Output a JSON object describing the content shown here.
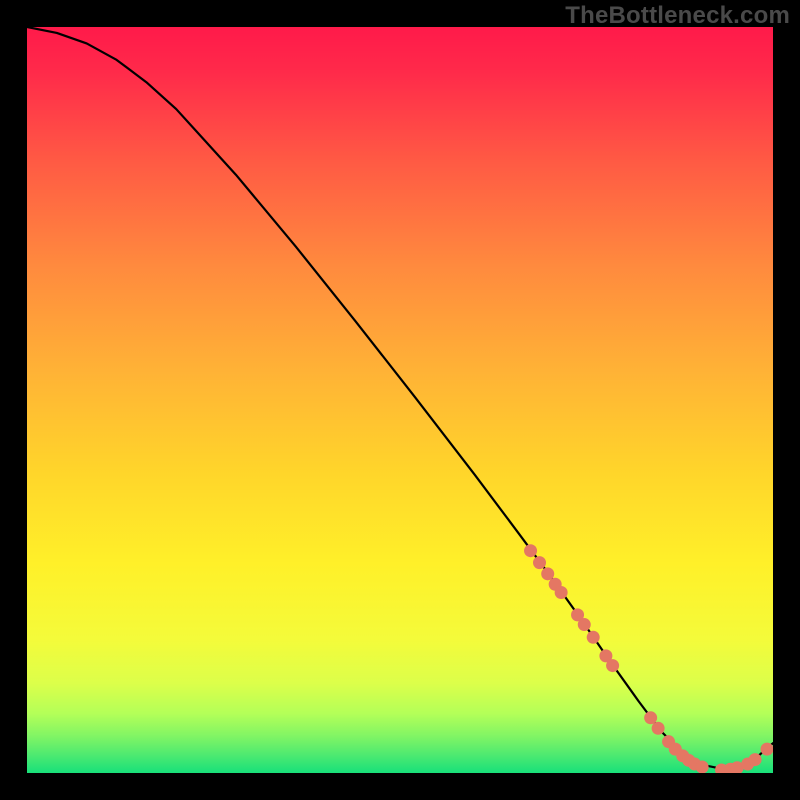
{
  "watermark": "TheBottleneck.com",
  "colors": {
    "background_black": "#000000",
    "gradient_top": "#ff1a4a",
    "gradient_mid": "#ffd600",
    "gradient_bottom": "#18e07a",
    "curve": "#000000",
    "marker": "#e47763"
  },
  "chart_data": {
    "type": "line",
    "title": "",
    "xlabel": "",
    "ylabel": "",
    "xlim": [
      0,
      100
    ],
    "ylim": [
      0,
      100
    ],
    "series": [
      {
        "name": "curve",
        "x": [
          0,
          4,
          8,
          12,
          16,
          20,
          28,
          36,
          44,
          52,
          60,
          66,
          70,
          74,
          78,
          82,
          85,
          88,
          91,
          94,
          97,
          100
        ],
        "y": [
          100,
          99.2,
          97.8,
          95.6,
          92.6,
          89.0,
          80.2,
          70.6,
          60.6,
          50.4,
          40.0,
          32.0,
          26.6,
          21.0,
          15.2,
          9.6,
          5.6,
          2.6,
          1.0,
          0.4,
          1.4,
          4.0
        ]
      }
    ],
    "markers": [
      {
        "x": 67.5,
        "y": 29.8
      },
      {
        "x": 68.7,
        "y": 28.2
      },
      {
        "x": 69.8,
        "y": 26.7
      },
      {
        "x": 70.8,
        "y": 25.3
      },
      {
        "x": 71.6,
        "y": 24.2
      },
      {
        "x": 73.8,
        "y": 21.2
      },
      {
        "x": 74.7,
        "y": 19.9
      },
      {
        "x": 75.9,
        "y": 18.2
      },
      {
        "x": 77.6,
        "y": 15.7
      },
      {
        "x": 78.5,
        "y": 14.4
      },
      {
        "x": 83.6,
        "y": 7.4
      },
      {
        "x": 84.6,
        "y": 6.0
      },
      {
        "x": 86.0,
        "y": 4.2
      },
      {
        "x": 86.9,
        "y": 3.2
      },
      {
        "x": 87.9,
        "y": 2.3
      },
      {
        "x": 88.7,
        "y": 1.7
      },
      {
        "x": 89.5,
        "y": 1.2
      },
      {
        "x": 90.5,
        "y": 0.8
      },
      {
        "x": 93.1,
        "y": 0.4
      },
      {
        "x": 94.3,
        "y": 0.5
      },
      {
        "x": 95.2,
        "y": 0.7
      },
      {
        "x": 96.6,
        "y": 1.2
      },
      {
        "x": 97.6,
        "y": 1.8
      },
      {
        "x": 99.2,
        "y": 3.2
      }
    ],
    "marker_radius_px": 6.5
  }
}
